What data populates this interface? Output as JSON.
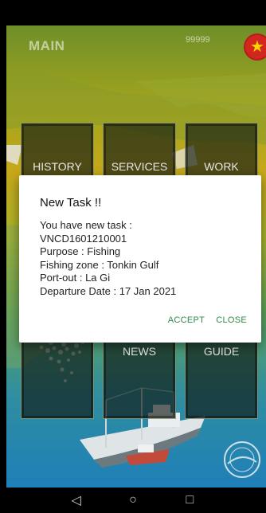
{
  "header": {
    "title": "MAIN",
    "code": "99999",
    "flag_icon": "vietnam-flag-icon"
  },
  "menu": {
    "history": "HISTORY",
    "services": "SERVICES",
    "work": "WORK",
    "news": "NEWS",
    "guide": "GUIDE"
  },
  "dialog": {
    "title": "New Task !!",
    "lines": [
      "You have new task :",
      "VNCD1601210001",
      "Purpose : Fishing",
      "Fishing zone : Tonkin Gulf",
      "Port-out : La Gi",
      "Departure Date : 17 Jan 2021"
    ],
    "accept": "ACCEPT",
    "close": "CLOSE"
  },
  "nav": {
    "back": "◁",
    "home": "○",
    "recents": "□"
  },
  "colors": {
    "accent": "#2f8a46",
    "flag_red": "#d2261e",
    "flag_star": "#ffd400"
  }
}
